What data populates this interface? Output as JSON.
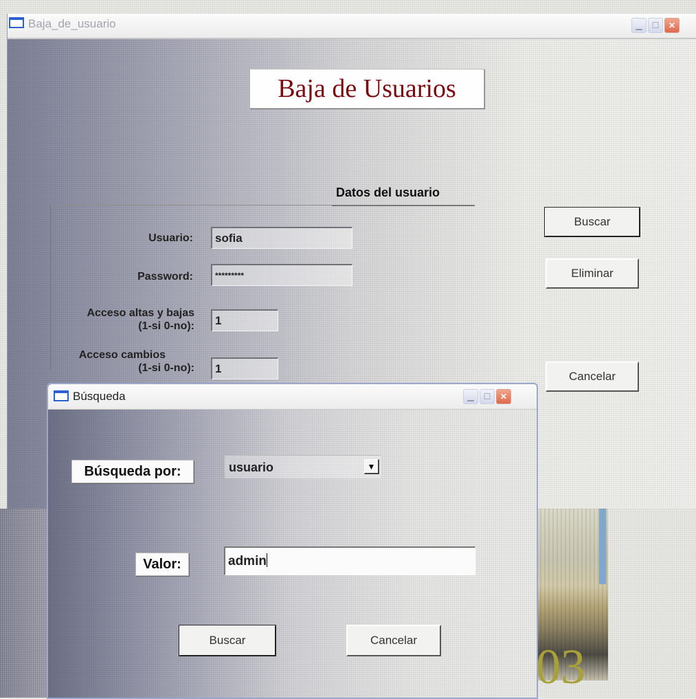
{
  "main_window": {
    "title": "Baja_de_usuario",
    "heading": "Baja de Usuarios",
    "section_title": "Datos del usuario",
    "fields": {
      "usuario": {
        "label": "Usuario:",
        "value": "sofia"
      },
      "password": {
        "label": "Password:",
        "value": "*********"
      },
      "acceso_altas": {
        "label_line1": "Acceso altas y bajas",
        "label_line2": "(1-si  0-no):",
        "value": "1"
      },
      "acceso_cambios": {
        "label_line1": "Acceso cambios",
        "label_line2": "(1-si 0-no):",
        "value": "1"
      }
    },
    "buttons": {
      "buscar": "Buscar",
      "eliminar": "Eliminar",
      "cancelar": "Cancelar"
    }
  },
  "dialog": {
    "title": "Búsqueda",
    "busqueda_por": {
      "label": "Búsqueda por:",
      "selected": "usuario"
    },
    "valor": {
      "label": "Valor:",
      "value": "admin"
    },
    "buttons": {
      "buscar": "Buscar",
      "cancelar": "Cancelar"
    }
  },
  "background": {
    "number_fragment": "03"
  },
  "colors": {
    "heading": "#7a0a10",
    "titlebar_icon": "#2c5fd0",
    "close_button": "#de6a4d"
  }
}
